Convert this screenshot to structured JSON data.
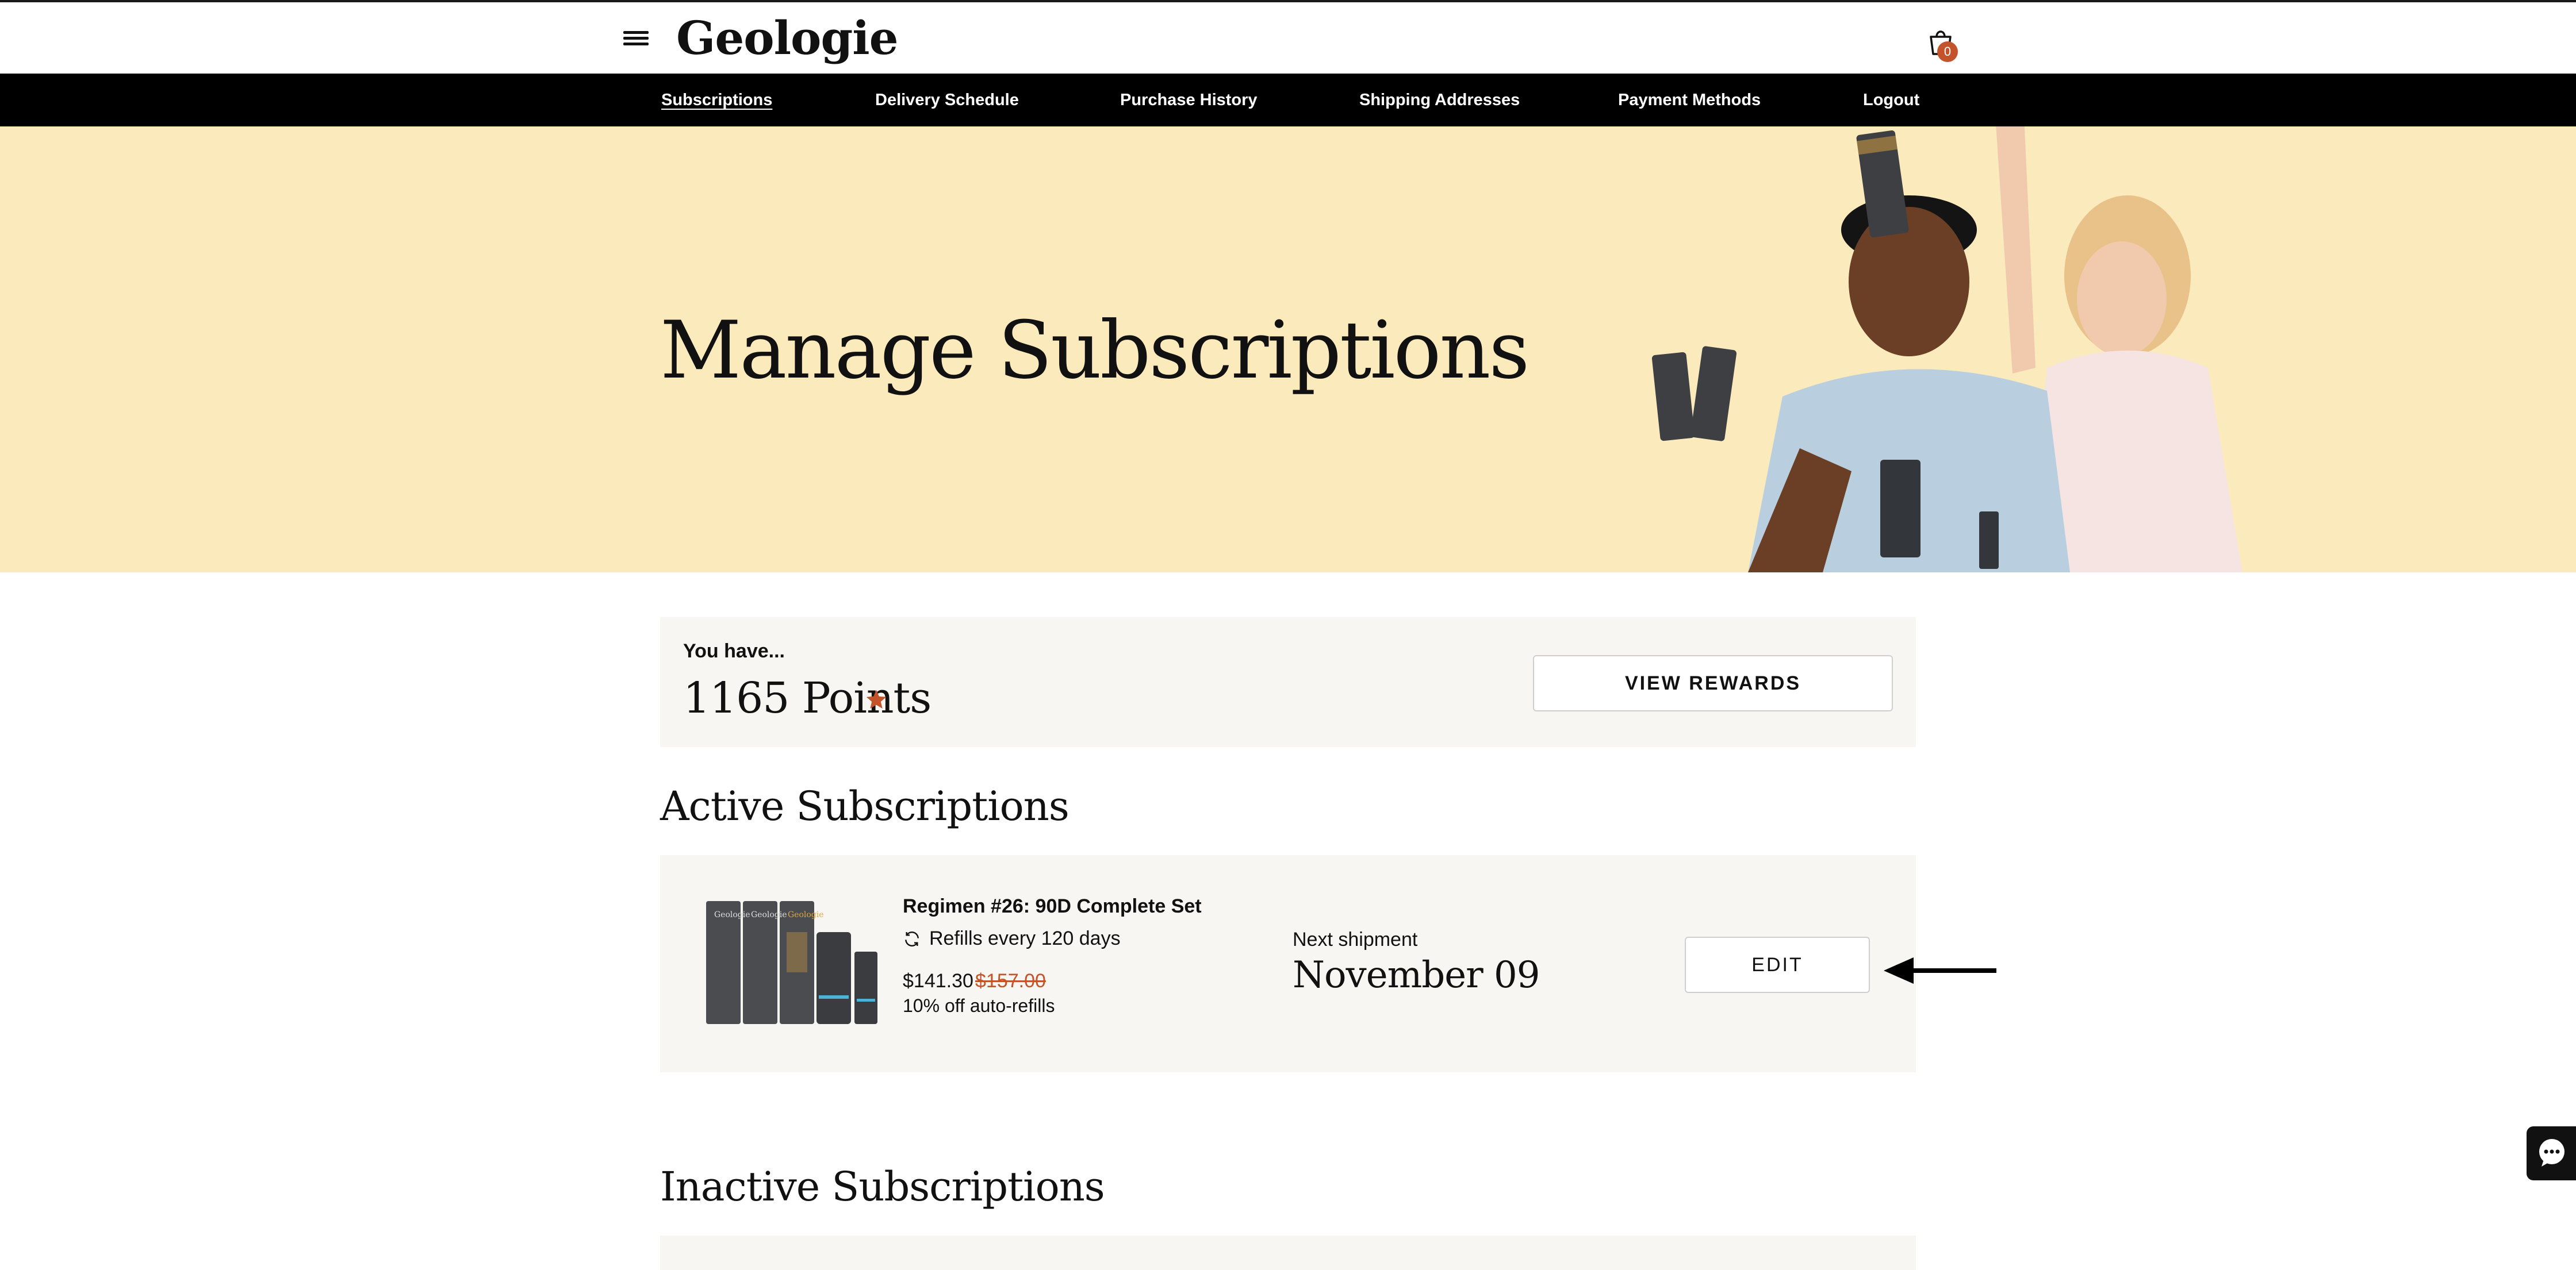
{
  "header": {
    "logo": "Geologie",
    "menu_icon": "hamburger-menu-icon",
    "cart_icon": "shopping-bag-icon",
    "cart_count": "0",
    "badge_color": "#c2532a"
  },
  "nav": {
    "items": [
      {
        "label": "Subscriptions",
        "active": true
      },
      {
        "label": "Delivery Schedule"
      },
      {
        "label": "Purchase History"
      },
      {
        "label": "Shipping Addresses"
      },
      {
        "label": "Payment Methods"
      },
      {
        "label": "Logout"
      }
    ]
  },
  "hero": {
    "title": "Manage Subscriptions",
    "background_color": "#fbeabc"
  },
  "points": {
    "caption": "You have...",
    "value": "1165 Points",
    "icon": "star-icon",
    "button_label": "VIEW REWARDS"
  },
  "active": {
    "title": "Active Subscriptions",
    "subscription": {
      "name": "Regimen #26: 90D Complete Set",
      "refill_icon": "refresh-icon",
      "refill_text": "Refills every 120 days",
      "price": "$141.30",
      "original_price": "$157.00",
      "discount": "10% off auto-refills",
      "next_label": "Next shipment",
      "next_date": "November 09",
      "edit_label": "EDIT"
    }
  },
  "inactive": {
    "title": "Inactive Subscriptions"
  },
  "chat": {
    "icon": "chat-bubble-icon"
  }
}
